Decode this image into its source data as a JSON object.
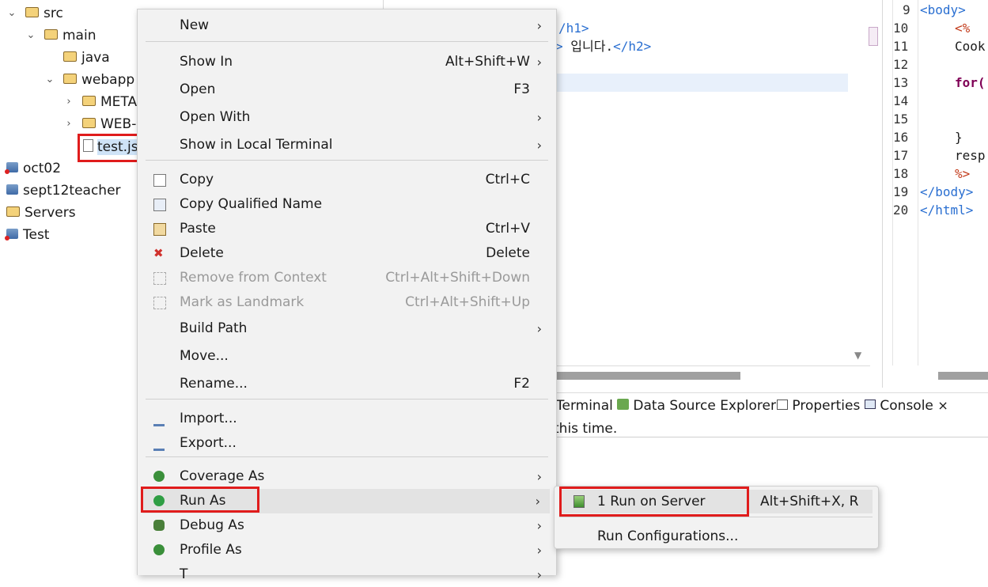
{
  "explorer": {
    "items": [
      {
        "label": "src"
      },
      {
        "label": "main"
      },
      {
        "label": "java"
      },
      {
        "label": "webapp"
      },
      {
        "label": "META"
      },
      {
        "label": "WEB-I"
      },
      {
        "label": "test.js"
      },
      {
        "label": "oct02"
      },
      {
        "label": "sept12teacher"
      },
      {
        "label": "Servers"
      },
      {
        "label": "Test"
      }
    ]
  },
  "editor_left": {
    "line1": "/h1>",
    "line2_korean": "입니다.",
    "line2_end": "</h2>"
  },
  "editor_right": {
    "lines": [
      {
        "no": "9",
        "text": "<body>"
      },
      {
        "no": "10",
        "text": "<%"
      },
      {
        "no": "11",
        "text": "Cook"
      },
      {
        "no": "12",
        "text": ""
      },
      {
        "no": "13",
        "text": "for("
      },
      {
        "no": "14",
        "text": ""
      },
      {
        "no": "15",
        "text": ""
      },
      {
        "no": "16",
        "text": "}"
      },
      {
        "no": "17",
        "text": "resp"
      },
      {
        "no": "18",
        "text": "%>"
      },
      {
        "no": "19",
        "text": "</body>"
      },
      {
        "no": "20",
        "text": "</html>"
      }
    ]
  },
  "bottom_panel": {
    "tabs": [
      {
        "label": "Terminal"
      },
      {
        "label": "Data Source Explorer"
      },
      {
        "label": "Properties"
      },
      {
        "label": "Console"
      }
    ],
    "close_glyph": "×",
    "console_text": "this time."
  },
  "context_menu": {
    "items": [
      {
        "label": "New",
        "shortcut": "",
        "submenu": true
      },
      {
        "label": "Show In",
        "shortcut": "Alt+Shift+W",
        "submenu": true
      },
      {
        "label": "Open",
        "shortcut": "F3",
        "submenu": false
      },
      {
        "label": "Open With",
        "shortcut": "",
        "submenu": true
      },
      {
        "label": "Show in Local Terminal",
        "shortcut": "",
        "submenu": true
      },
      {
        "label": "Copy",
        "shortcut": "Ctrl+C",
        "submenu": false
      },
      {
        "label": "Copy Qualified Name",
        "shortcut": "",
        "submenu": false
      },
      {
        "label": "Paste",
        "shortcut": "Ctrl+V",
        "submenu": false
      },
      {
        "label": "Delete",
        "shortcut": "Delete",
        "submenu": false
      },
      {
        "label": "Remove from Context",
        "shortcut": "Ctrl+Alt+Shift+Down",
        "submenu": false,
        "disabled": true
      },
      {
        "label": "Mark as Landmark",
        "shortcut": "Ctrl+Alt+Shift+Up",
        "submenu": false,
        "disabled": true
      },
      {
        "label": "Build Path",
        "shortcut": "",
        "submenu": true
      },
      {
        "label": "Move...",
        "shortcut": "",
        "submenu": false
      },
      {
        "label": "Rename...",
        "shortcut": "F2",
        "submenu": false
      },
      {
        "label": "Import...",
        "shortcut": "",
        "submenu": false
      },
      {
        "label": "Export...",
        "shortcut": "",
        "submenu": false
      },
      {
        "label": "Coverage As",
        "shortcut": "",
        "submenu": true
      },
      {
        "label": "Run As",
        "shortcut": "",
        "submenu": true
      },
      {
        "label": "Debug As",
        "shortcut": "",
        "submenu": true
      },
      {
        "label": "Profile As",
        "shortcut": "",
        "submenu": true
      },
      {
        "label": "T",
        "shortcut": "",
        "submenu": true
      }
    ],
    "arrow": "›"
  },
  "submenu": {
    "items": [
      {
        "label": "1 Run on Server",
        "shortcut": "Alt+Shift+X, R"
      },
      {
        "label": "Run Configurations..."
      }
    ]
  },
  "colors": {
    "highlight_box": "#e01c1c",
    "menu_bg": "#f2f2f2",
    "tag": "#2a6fd1",
    "jsp": "#c23a1a",
    "keyword": "#7f0055"
  }
}
